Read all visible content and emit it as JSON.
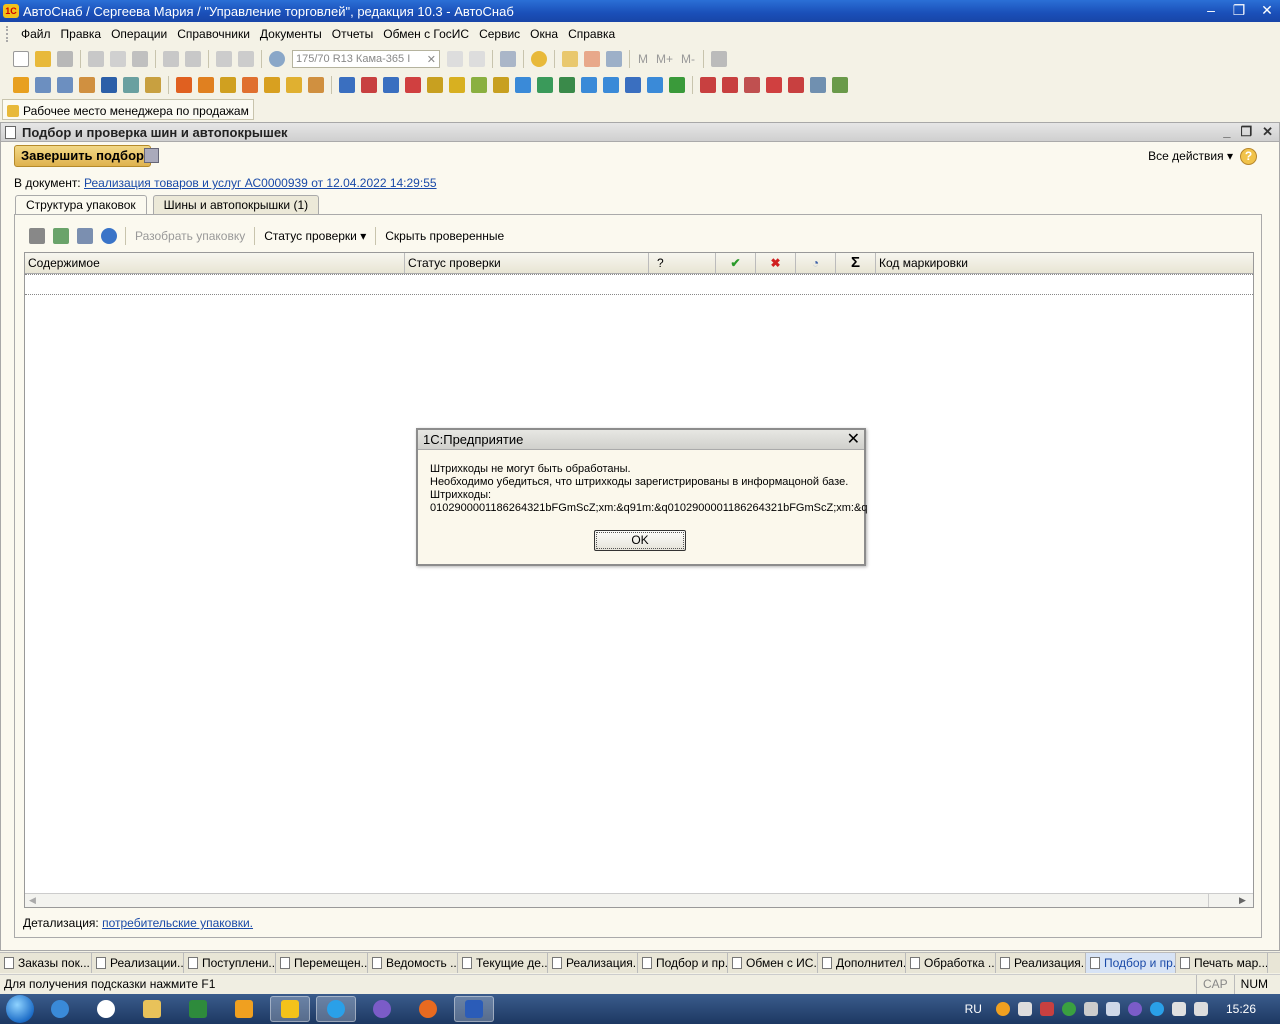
{
  "window": {
    "title": "АвтоСнаб / Сергеева Мария / \"Управление торговлей\", редакция 10.3 - АвтоСнаб"
  },
  "menu": [
    "Файл",
    "Правка",
    "Операции",
    "Справочники",
    "Документы",
    "Отчеты",
    "Обмен с ГосИС",
    "Сервис",
    "Окна",
    "Справка"
  ],
  "toolbar": {
    "search_value": "175/70 R13 Кама-365 I",
    "m_labels": [
      "M",
      "M+",
      "M-"
    ]
  },
  "workplace": {
    "label": "Рабочее место менеджера по продажам"
  },
  "subwindow": {
    "title": "Подбор и проверка шин и автопокрышек",
    "finish_button": "Завершить подбор",
    "all_actions": "Все действия",
    "help": "?",
    "doc_label": "В документ:",
    "doc_link": "Реализация товаров и услуг АС0000939 от 12.04.2022 14:29:55",
    "tabs": [
      "Структура упаковок",
      "Шины и автопокрышки (1)"
    ],
    "grid_toolbar": {
      "unpack": "Разобрать упаковку",
      "status": "Статус проверки",
      "hide": "Скрыть проверенные"
    },
    "columns": {
      "content": "Содержимое",
      "status": "Статус проверки",
      "question": "?",
      "sum": "Σ",
      "code": "Код маркировки"
    },
    "detail_label": "Детализация:",
    "detail_link": "потребительские упаковки."
  },
  "dialog": {
    "title": "1С:Предприятие",
    "line1": "Штрихкоды не могут быть обработаны.",
    "line2": "Необходимо убедиться, что штрихкоды зарегистрированы в информацоной базе.",
    "line3": "Штрихкоды:",
    "line4": "0102900001186264321bFGmScZ;xm:&q91m:&q0102900001186264321bFGmScZ;xm:&q",
    "ok": "OK"
  },
  "window_tabs": [
    "Заказы пок...",
    "Реализации...",
    "Поступлени...",
    "Перемещен...",
    "Ведомость ...",
    "Текущие де...",
    "Реализация...",
    "Подбор и пр...",
    "Обмен с ИС...",
    "Дополнител...",
    "Обработка ...",
    "Реализация...",
    "Подбор и пр...",
    "Печать мар..."
  ],
  "status": {
    "hint": "Для получения подсказки нажмите F1",
    "cap": "CAP",
    "num": "NUM"
  },
  "taskbar": {
    "lang": "RU",
    "time": "15:26"
  },
  "colors": {
    "titlebar": "#1a4fb8",
    "accent_button": "#dfb24e",
    "link": "#1a4aa8",
    "check": "#2a9a2a",
    "cross": "#d02020"
  }
}
